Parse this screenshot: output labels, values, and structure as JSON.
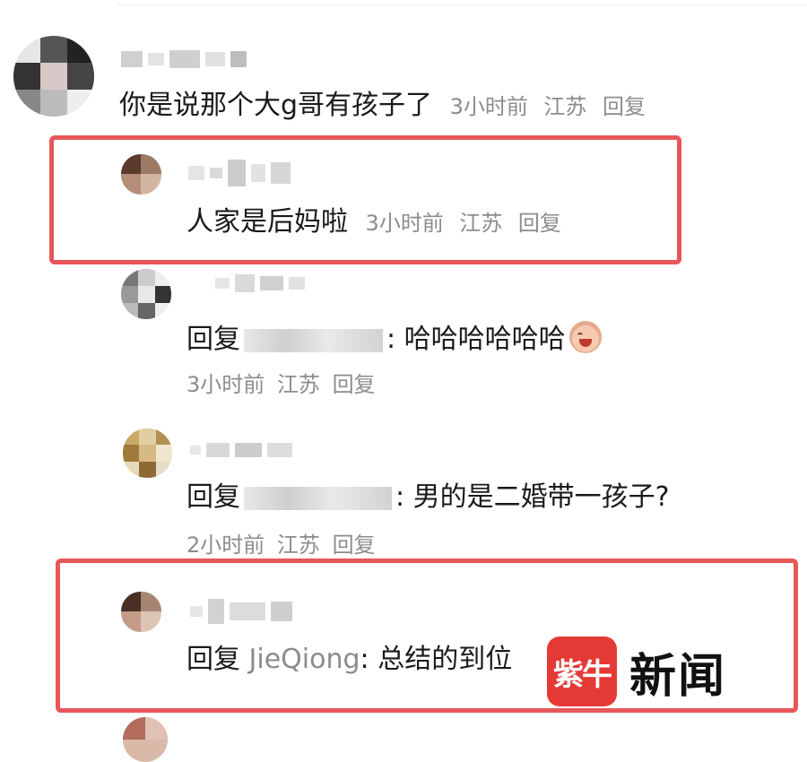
{
  "comments": [
    {
      "text": "你是说那个大g哥有孩子了",
      "time": "3小时前",
      "location": "江苏",
      "reply": "回复"
    },
    {
      "text": "人家是后妈啦",
      "time": "3小时前",
      "location": "江苏",
      "reply": "回复"
    },
    {
      "reply_prefix": "回复",
      "text": ": 哈哈哈哈哈哈",
      "emoji": "crying-laughing-emoji",
      "time": "3小时前",
      "location": "江苏",
      "reply": "回复"
    },
    {
      "reply_prefix": "回复",
      "text": ": 男的是二婚带一孩子?",
      "time": "2小时前",
      "location": "江苏",
      "reply": "回复"
    },
    {
      "reply_prefix": "回复",
      "mention": "JieQiong",
      "text": ": 总结的到位"
    }
  ],
  "watermark": {
    "logo": "紫牛",
    "text": "新闻"
  },
  "colors": {
    "highlight_box": "#e8565a",
    "meta_text": "#8c8c8c",
    "watermark_red": "#e53935"
  }
}
